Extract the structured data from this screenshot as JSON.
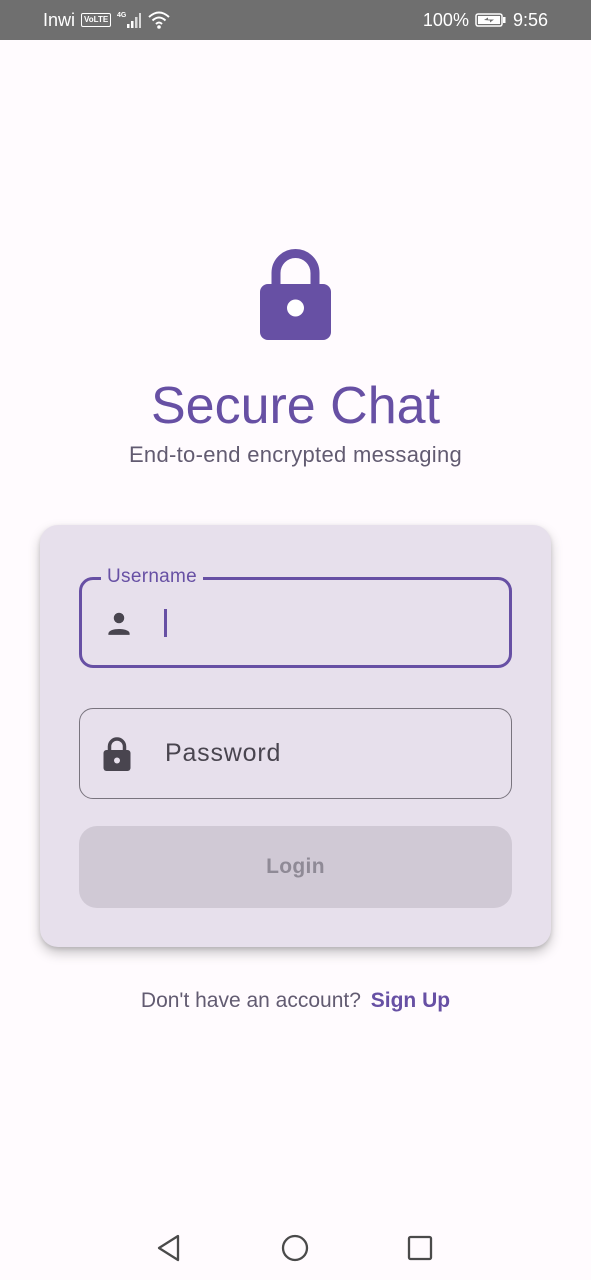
{
  "status_bar": {
    "carrier": "Inwi",
    "volte": "VoLTE",
    "network": "4G",
    "battery": "100%",
    "time": "9:56",
    "icons": [
      "signal-icon",
      "wifi-icon",
      "battery-charging-icon"
    ]
  },
  "header": {
    "icon": "lock-icon",
    "title": "Secure Chat",
    "subtitle": "End-to-end encrypted messaging"
  },
  "login_form": {
    "username": {
      "label": "Username",
      "value": "",
      "icon": "person-icon",
      "focused": true
    },
    "password": {
      "placeholder": "Password",
      "value": "",
      "icon": "lock-icon"
    },
    "login_label": "Login",
    "login_enabled": false
  },
  "signup": {
    "prompt": "Don't have an account?",
    "link": "Sign Up"
  },
  "nav_bar": {
    "buttons": [
      "back-icon",
      "home-icon",
      "recents-icon"
    ]
  },
  "colors": {
    "primary": "#6750a4",
    "background": "#fffbfe",
    "card": "#e7e0ec",
    "status_bar": "#6f6f6f",
    "button_disabled": "#d0c9d5",
    "text_secondary": "#625b71"
  }
}
